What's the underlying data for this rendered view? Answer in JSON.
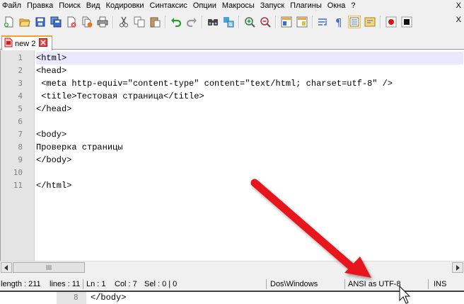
{
  "menu": {
    "items": [
      "Файл",
      "Правка",
      "Поиск",
      "Вид",
      "Кодировки",
      "Синтаксис",
      "Опции",
      "Макросы",
      "Запуск",
      "Плагины",
      "Окна",
      "?"
    ],
    "close": "X"
  },
  "toolbar": {
    "buttons": [
      "new-file-icon",
      "open-file-icon",
      "save-icon",
      "save-all-icon",
      "close-icon",
      "close-all-icon",
      "print-icon",
      "cut-icon",
      "copy-icon",
      "paste-icon",
      "undo-icon",
      "redo-icon",
      "find-icon",
      "replace-icon",
      "zoom-in-icon",
      "zoom-out-icon",
      "sync-vertical-icon",
      "sync-horizontal-icon",
      "word-wrap-icon",
      "show-all-chars-icon",
      "indent-guide-icon",
      "user-lang-icon",
      "record-macro-icon",
      "stop-macro-icon"
    ],
    "close": "X"
  },
  "tab": {
    "label": "new 2"
  },
  "editor": {
    "lines": [
      {
        "no": "1",
        "text": "<html>"
      },
      {
        "no": "2",
        "text": "<head>"
      },
      {
        "no": "3",
        "text": " <meta http-equiv=\"content-type\" content=\"text/html; charset=utf-8\" />"
      },
      {
        "no": "4",
        "text": " <title>Тестовая страница</title>"
      },
      {
        "no": "5",
        "text": "</head>"
      },
      {
        "no": "6",
        "text": ""
      },
      {
        "no": "7",
        "text": "<body>"
      },
      {
        "no": "8",
        "text": "Проверка страницы"
      },
      {
        "no": "9",
        "text": "</body>"
      },
      {
        "no": "10",
        "text": ""
      },
      {
        "no": "11",
        "text": "</html>"
      }
    ]
  },
  "status": {
    "length": "length : 211",
    "lines": "lines : 11",
    "ln": "Ln : 1",
    "col": "Col : 7",
    "sel": "Sel : 0 | 0",
    "eol": "Dos\\Windows",
    "encoding": "ANSI as UTF-8",
    "mode": "INS"
  },
  "behind_window": {
    "line_no": "8",
    "text": "</body>"
  },
  "colors": {
    "arrow": "#e8141a",
    "tab_accent": "#f6a12c",
    "gutter": "#e4e4e4"
  }
}
